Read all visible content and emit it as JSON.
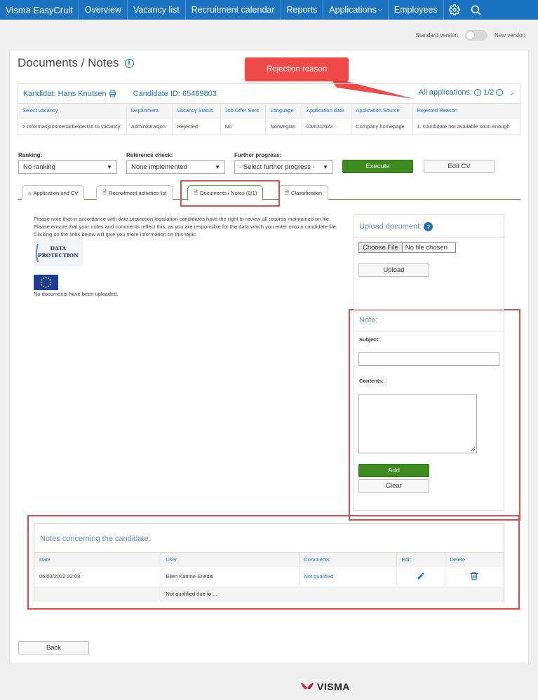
{
  "nav": {
    "brand": "Visma EasyCruit",
    "items": [
      "Overview",
      "Vacancy list",
      "Recruitment calendar",
      "Reports",
      "Applications",
      "Employees"
    ]
  },
  "version": {
    "standard": "Standard version",
    "new": "New version"
  },
  "page": {
    "title": "Documents / Notes"
  },
  "callout": {
    "text": "Rejection reason"
  },
  "candidate": {
    "name_label": "Kandidat: Hans Knutsen",
    "id_label": "Candidate ID: 65469803",
    "all_applications": "All applications:",
    "pager": "1/2"
  },
  "vacancy_table": {
    "headers": [
      "Select vacancy",
      "Department",
      "Vacancy Status",
      "Job Offer Sent",
      "Language",
      "Application date",
      "Application Source",
      "Rejected Reason"
    ],
    "row": {
      "vacancy": "> Informasjonsmedarbeider",
      "go_to": "Go to vacancy",
      "department": "Administrasjon",
      "status": "Rejected",
      "offer": "No",
      "language": "Norwegian",
      "date": "03/03/2022",
      "source": "Company homepage",
      "reason": "1. Candidate not available soon enough"
    }
  },
  "controls": {
    "ranking_label": "Ranking:",
    "ranking_value": "No ranking",
    "reference_label": "Reference check:",
    "reference_value": "None implemented",
    "progress_label": "Further progress:",
    "progress_value": "- Select further progress -",
    "execute": "Execute",
    "edit_cv": "Edit CV"
  },
  "tabs": [
    "Application and CV",
    "Recruitment activities list",
    "Documents / Notes (0/1)",
    "Classification"
  ],
  "notice": "Please note that in accordance with data protection legislation candidates have the right to review all records maintained on file. Please ensure that your notes and comments reflect this, as you are responsible for the data which you enter onto a candidate file. Clicking on the links below will give you more information on this topic.",
  "dp_logo": {
    "line1": "Data",
    "line2": "Protection"
  },
  "no_docs": "No documents have been uploaded.",
  "upload": {
    "title": "Upload document:",
    "choose": "Choose File",
    "no_file": "No file chosen",
    "button": "Upload"
  },
  "note_form": {
    "title": "Note:",
    "subject": "Subject:",
    "contents": "Contents:",
    "add": "Add",
    "clear": "Clear"
  },
  "notes": {
    "title": "Notes concerning the candidate:",
    "headers": [
      "Date",
      "User",
      "Comments",
      "Edit",
      "Delete"
    ],
    "row": {
      "date": "06/03/2022 22:03",
      "user": "Ellen Katrine Snedal",
      "comment": "Not qualified",
      "detail": "Not qualified due to ..."
    }
  },
  "back": "Back",
  "footer": {
    "brand": "VISMA"
  },
  "colors": {
    "nav": "#1b72c0",
    "green": "#3d8a1f",
    "highlight": "#e04c4c"
  }
}
